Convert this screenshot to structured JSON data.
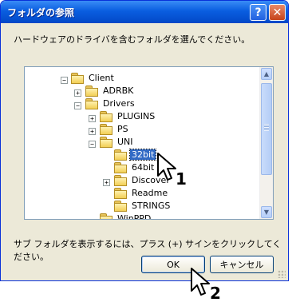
{
  "window": {
    "title": "フォルダの参照",
    "help_icon": "help-icon",
    "close_icon": "close-icon",
    "help_label": "?",
    "close_label": "✕"
  },
  "instruction": "ハードウェアのドライバを含むフォルダを選んでください。",
  "tree": {
    "items": [
      {
        "label": "Client",
        "expander": "minus"
      },
      {
        "label": "ADRBK",
        "expander": "plus"
      },
      {
        "label": "Drivers",
        "expander": "minus"
      },
      {
        "label": "PLUGINS",
        "expander": "plus"
      },
      {
        "label": "PS",
        "expander": "plus"
      },
      {
        "label": "UNI",
        "expander": "minus"
      },
      {
        "label": "32bit",
        "selected": true
      },
      {
        "label": "64bit"
      },
      {
        "label": "Discover",
        "expander": "plus"
      },
      {
        "label": "Readme"
      },
      {
        "label": "STRINGS"
      },
      {
        "label": "WinPPD"
      }
    ],
    "expander_symbols": {
      "minus": "−",
      "plus": "+"
    }
  },
  "hint": "サブ フォルダを表示するには、プラス (+) サインをクリックしてください。",
  "buttons": {
    "ok": "OK",
    "cancel": "キャンセル"
  },
  "callouts": {
    "one": "1",
    "two": "2"
  }
}
